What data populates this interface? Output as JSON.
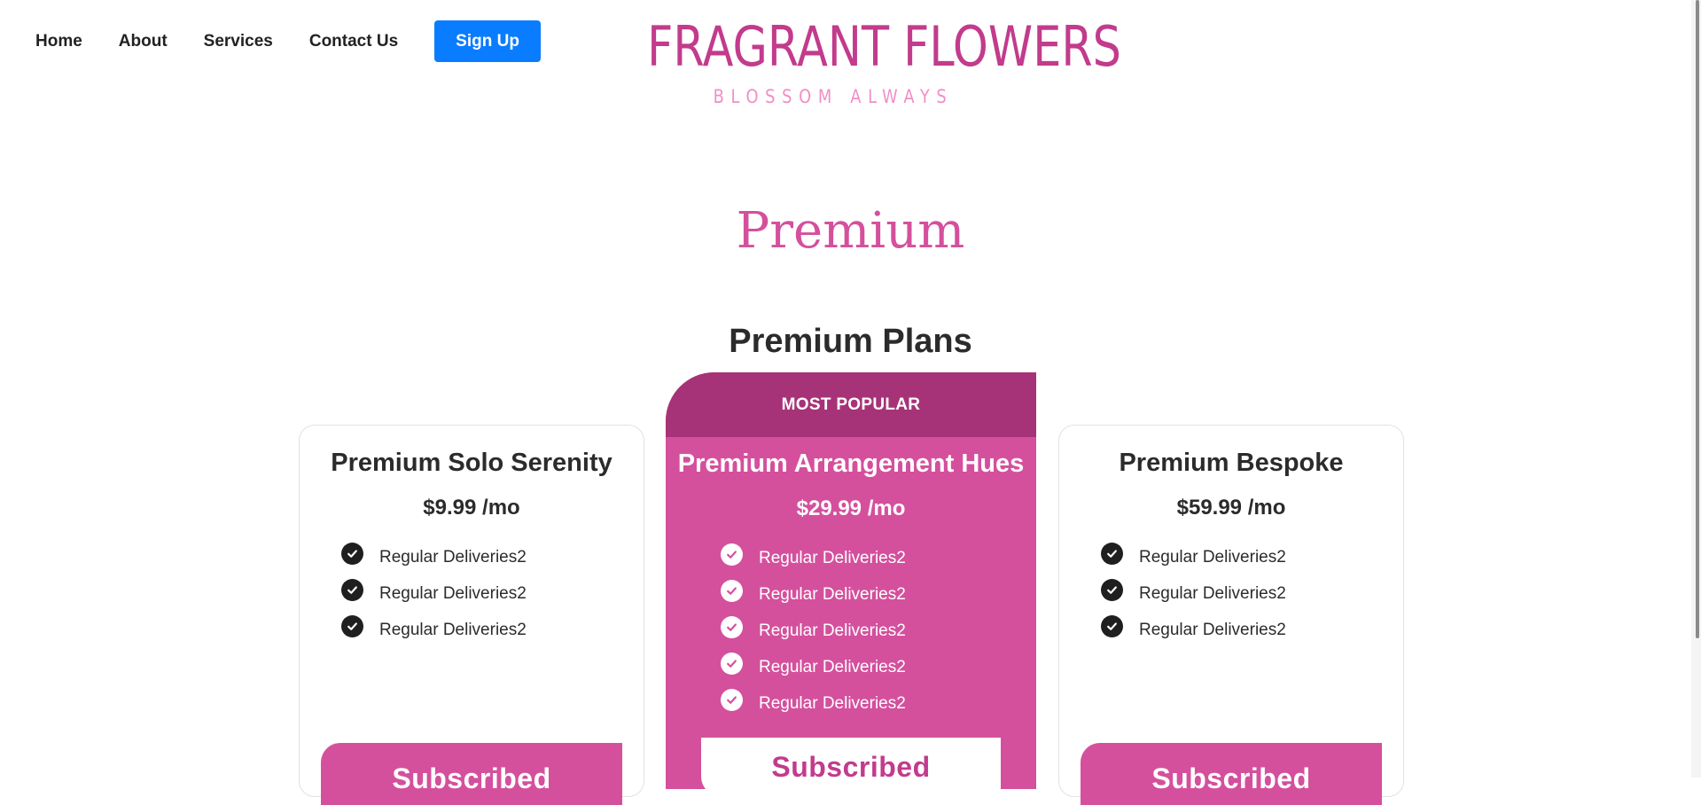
{
  "nav": {
    "items": [
      {
        "label": "Home"
      },
      {
        "label": "About"
      },
      {
        "label": "Services"
      },
      {
        "label": "Contact Us"
      }
    ],
    "signup_label": "Sign Up"
  },
  "logo": {
    "title": "FRAGRANT FLOWERS",
    "tagline": "BLOSSOM ALWAYS"
  },
  "page": {
    "title": "Premium",
    "section_title": "Premium Plans"
  },
  "plans": [
    {
      "name": "Premium Solo Serenity",
      "price": "$9.99 /mo",
      "features": [
        "Regular Deliveries2",
        "Regular Deliveries2",
        "Regular Deliveries2"
      ],
      "button_label": "Subscribed"
    },
    {
      "badge": "MOST POPULAR",
      "name": "Premium Arrangement Hues",
      "price": "$29.99 /mo",
      "features": [
        "Regular Deliveries2",
        "Regular Deliveries2",
        "Regular Deliveries2",
        "Regular Deliveries2",
        "Regular Deliveries2"
      ],
      "button_label": "Subscribed"
    },
    {
      "name": "Premium Bespoke",
      "price": "$59.99 /mo",
      "features": [
        "Regular Deliveries2",
        "Regular Deliveries2",
        "Regular Deliveries2"
      ],
      "button_label": "Subscribed"
    }
  ],
  "colors": {
    "brand_pink": "#d4509d",
    "brand_dark_pink": "#a63377",
    "logo_pink": "#c23b8c",
    "tagline_pink": "#f28ec6",
    "signup_blue": "#0a7cff"
  },
  "icons": {
    "feature_check": "check-circle-icon"
  }
}
